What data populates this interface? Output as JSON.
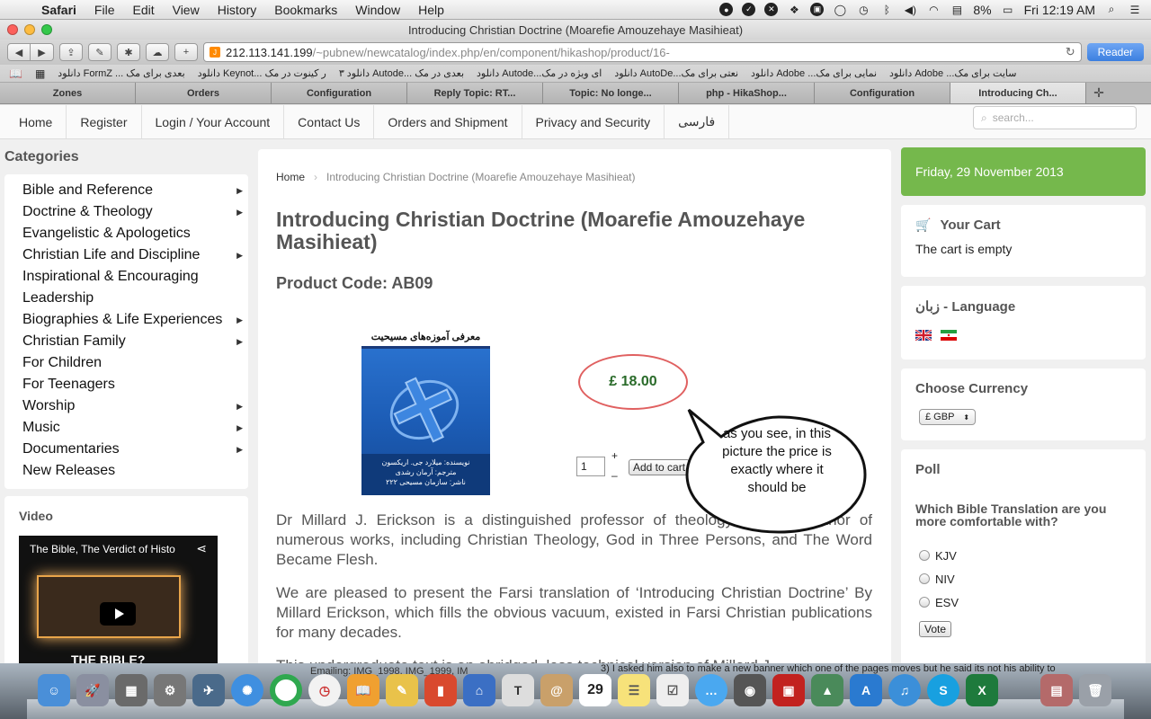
{
  "menubar": {
    "app": "Safari",
    "items": [
      "File",
      "Edit",
      "View",
      "History",
      "Bookmarks",
      "Window",
      "Help"
    ],
    "battery": "8%",
    "clock": "Fri 12:19 AM"
  },
  "window": {
    "title": "Introducing Christian Doctrine (Moarefie Amouzehaye Masihieat)",
    "url_host": "212.113.141.199",
    "url_path": "/~pubnew/newcatalog/index.php/en/component/hikashop/product/16-",
    "reader_label": "Reader"
  },
  "bookmarks": [
    "دانلود Adobe ...سایت برای مک",
    "دانلود Adobe ...نمایی برای مک",
    "دانلود AutoDe...نعتی برای مک",
    "دانلود Autode...ای ویژه در مک",
    "دانلود ۳ Autode... بعدی در مک",
    "دانلود Keynot... ر کینوت در مک",
    "دانلود FormZ ... بعدی برای مک"
  ],
  "tabs": [
    "Zones",
    "Orders",
    "Configuration",
    "Reply Topic: RT...",
    "Topic: No longe...",
    "php - HikaShop...",
    "Configuration",
    "Introducing Ch..."
  ],
  "topnav": {
    "items": [
      "Home",
      "Register",
      "Login / Your Account",
      "Contact Us",
      "Orders and Shipment",
      "Privacy and Security",
      "فارسی"
    ],
    "search_placeholder": "search..."
  },
  "categories": {
    "title": "Categories",
    "items": [
      {
        "label": "Bible and Reference",
        "sub": true
      },
      {
        "label": "Doctrine & Theology",
        "sub": true
      },
      {
        "label": "Evangelistic & Apologetics",
        "sub": false
      },
      {
        "label": "Christian Life and Discipline",
        "sub": true
      },
      {
        "label": "Inspirational & Encouraging",
        "sub": false
      },
      {
        "label": "Leadership",
        "sub": false
      },
      {
        "label": "Biographies & Life Experiences",
        "sub": true
      },
      {
        "label": "Christian Family",
        "sub": true
      },
      {
        "label": "For Children",
        "sub": false
      },
      {
        "label": "For Teenagers",
        "sub": false
      },
      {
        "label": "Worship",
        "sub": true
      },
      {
        "label": "Music",
        "sub": true
      },
      {
        "label": "Documentaries",
        "sub": true
      },
      {
        "label": "New Releases",
        "sub": false
      }
    ]
  },
  "video": {
    "title": "Video",
    "clip_title": "The Bible, The Verdict of Histo",
    "caption": "THE BIBLE?"
  },
  "breadcrumb": {
    "home": "Home",
    "current": "Introducing Christian Doctrine (Moarefie Amouzehaye Masihieat)"
  },
  "product": {
    "title": "Introducing Christian Doctrine (Moarefie Amouzehaye Masihieat)",
    "code": "Product Code: AB09",
    "cover_title": "معرفی آموزه‌های مسیحیت",
    "cover_credits": [
      "نویسنده: میلارد جی. اریکسون",
      "مترجم: آرمان رشدی",
      "ناشر: سازمان مسیحی ۲۲۲"
    ],
    "price": "£ 18.00",
    "qty": "1",
    "plus": "+",
    "minus": "–",
    "add_to_cart": "Add to cart",
    "desc1": "Dr Millard J. Erickson is a distinguished professor of theology and the author of numerous works, including Christian Theology, God in Three Persons, and The Word Became Flesh.",
    "desc2": "We are pleased to present the Farsi translation of ‘Introducing Christian Doctrine’ By Millard Erickson, which fills the obvious vacuum, existed in Farsi Christian publications for many decades.",
    "desc3": "This undergraduate text is an abridged, less technical version of Millard J."
  },
  "annotation": "as you see, in this picture the price is exactly where it should be",
  "sidebar": {
    "date": "Friday, 29 November 2013",
    "cart_title": "Your Cart",
    "cart_status": "The cart is empty",
    "language_title": "زبان - Language",
    "currency_title": "Choose Currency",
    "currency_value": "£ GBP",
    "poll_title": "Poll",
    "poll_question": "Which Bible Translation are you more comfortable with?",
    "poll_options": [
      "KJV",
      "NIV",
      "ESV"
    ],
    "vote_label": "Vote"
  },
  "dock": {
    "text_left": "Emailing: IMG_1998, IMG_1999, IM",
    "text_right": "3) I asked him also to make a new banner which one of the pages moves but he said its not his ability to",
    "calendar_day": "29"
  },
  "colors": {
    "green_date": "#75b84c",
    "price_green": "#2a6b2a",
    "oval_red": "#e06060",
    "reader_blue": "#3b7fe0"
  }
}
